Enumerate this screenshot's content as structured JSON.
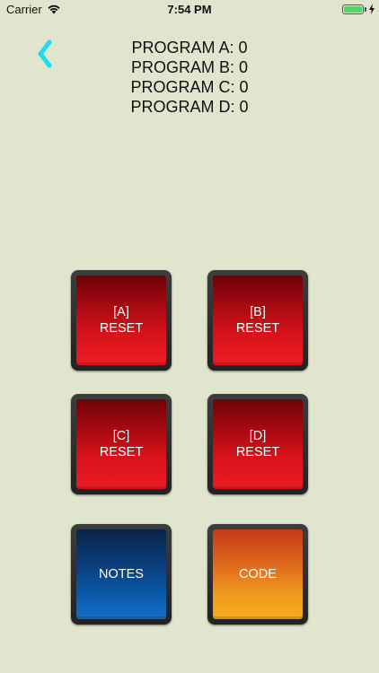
{
  "status_bar": {
    "carrier": "Carrier",
    "time": "7:54 PM",
    "battery_color": "#4cd964"
  },
  "nav": {
    "back_icon": "chevron-left-icon",
    "back_color": "#1bdcf0"
  },
  "programs": [
    "PROGRAM A: 0",
    "PROGRAM B: 0",
    "PROGRAM C: 0",
    "PROGRAM D: 0"
  ],
  "buttons": {
    "reset_a": {
      "line1": "[A]",
      "line2": "RESET"
    },
    "reset_b": {
      "line1": "[B]",
      "line2": "RESET"
    },
    "reset_c": {
      "line1": "[C]",
      "line2": "RESET"
    },
    "reset_d": {
      "line1": "[D]",
      "line2": "RESET"
    },
    "notes": {
      "label": "NOTES"
    },
    "code": {
      "label": "CODE"
    }
  },
  "colors": {
    "background": "#e0e5cd",
    "reset_red": "#ee1c24",
    "notes_blue": "#0a58a8",
    "code_orange": "#f09a1d"
  }
}
